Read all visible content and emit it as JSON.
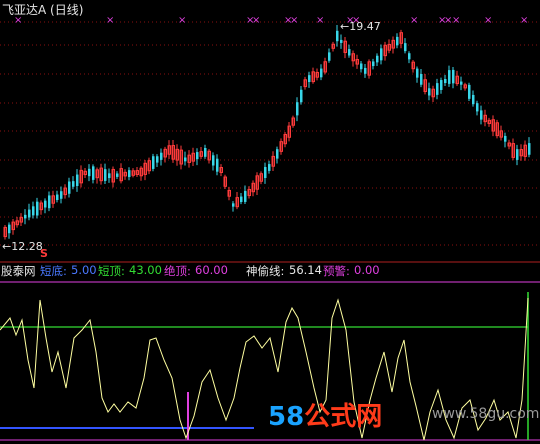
{
  "window": {
    "title": "飞亚达A (日线)"
  },
  "price_panel": {
    "high_label": "19.47",
    "low_label": "12.28",
    "s_marker": "S"
  },
  "indicator_bar": {
    "name": "股泰网",
    "items": [
      {
        "label": "短底:",
        "value": "5.00",
        "color": "#4a78ff"
      },
      {
        "label": "短顶:",
        "value": "43.00",
        "color": "#33dd33"
      },
      {
        "label": "绝顶:",
        "value": "60.00",
        "color": "#e040e0"
      },
      {
        "label": "神偷线:",
        "value": "56.14",
        "color": "#e6e6e6"
      },
      {
        "label": "预警:",
        "value": "0.00",
        "color": "#e040e0"
      }
    ]
  },
  "watermark": {
    "text_58": "58",
    "text_cn": "公式网",
    "url": "www.58gu.com"
  },
  "colors": {
    "up": "#ff3b3b",
    "down": "#38d6e8",
    "grid": "#8a1010",
    "osc": "#ffffa0",
    "green_line": "#33dd33",
    "blue_line": "#3355ff",
    "magenta": "#e040e0"
  }
}
